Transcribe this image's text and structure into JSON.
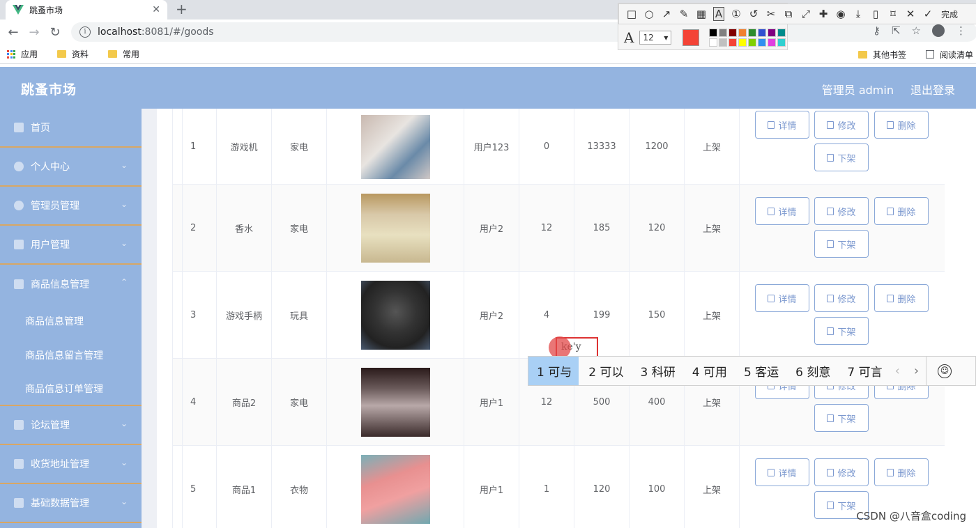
{
  "browser": {
    "tab_title": "跳蚤市场",
    "url_host": "localhost",
    "url_rest": ":8081/#/goods",
    "bookmarks": [
      "应用",
      "资料",
      "常用"
    ],
    "bookmarks_right": [
      "其他书签",
      "阅读清单"
    ]
  },
  "snip_tool": {
    "done_label": "完成",
    "font_size": "12",
    "current_color": "#f44336",
    "palette": [
      "#000000",
      "#808080",
      "#800000",
      "#f08030",
      "#2e8b2e",
      "#3050d0",
      "#800080",
      "#008b8b",
      "#ffffff",
      "#c0c0c0",
      "#f44336",
      "#ffff00",
      "#80d000",
      "#3090f0",
      "#e040e0",
      "#30d0d0"
    ]
  },
  "header": {
    "brand": "跳蚤市场",
    "admin_label": "管理员 admin",
    "logout_label": "退出登录"
  },
  "sidebar": {
    "items": [
      {
        "label": "首页"
      },
      {
        "label": "个人中心"
      },
      {
        "label": "管理员管理"
      },
      {
        "label": "用户管理"
      },
      {
        "label": "商品信息管理"
      }
    ],
    "sub_items": [
      "商品信息管理",
      "商品信息留言管理",
      "商品信息订单管理"
    ],
    "items_after": [
      {
        "label": "论坛管理"
      },
      {
        "label": "收货地址管理"
      },
      {
        "label": "基础数据管理"
      }
    ]
  },
  "table": {
    "rows": [
      {
        "idx": "1",
        "name": "游戏机",
        "type": "家电",
        "user": "用户123",
        "a": "0",
        "b": "13333",
        "c": "1200",
        "status": "上架"
      },
      {
        "idx": "2",
        "name": "香水",
        "type": "家电",
        "user": "用户2",
        "a": "12",
        "b": "185",
        "c": "120",
        "status": "上架"
      },
      {
        "idx": "3",
        "name": "游戏手柄",
        "type": "玩具",
        "user": "用户2",
        "a": "4",
        "b": "199",
        "c": "150",
        "status": "上架"
      },
      {
        "idx": "4",
        "name": "商品2",
        "type": "家电",
        "user": "用户1",
        "a": "12",
        "b": "500",
        "c": "400",
        "status": "上架"
      },
      {
        "idx": "5",
        "name": "商品1",
        "type": "衣物",
        "user": "用户1",
        "a": "1",
        "b": "120",
        "c": "100",
        "status": "上架"
      }
    ],
    "buttons": {
      "detail": "详情",
      "edit": "修改",
      "delete": "删除",
      "off": "下架"
    }
  },
  "ime": {
    "composition": "ke'y",
    "candidates": [
      "1 可与",
      "2 可以",
      "3 科研",
      "4 可用",
      "5 客运",
      "6 刻意",
      "7 可言"
    ]
  },
  "watermark": "CSDN @八音盒coding"
}
